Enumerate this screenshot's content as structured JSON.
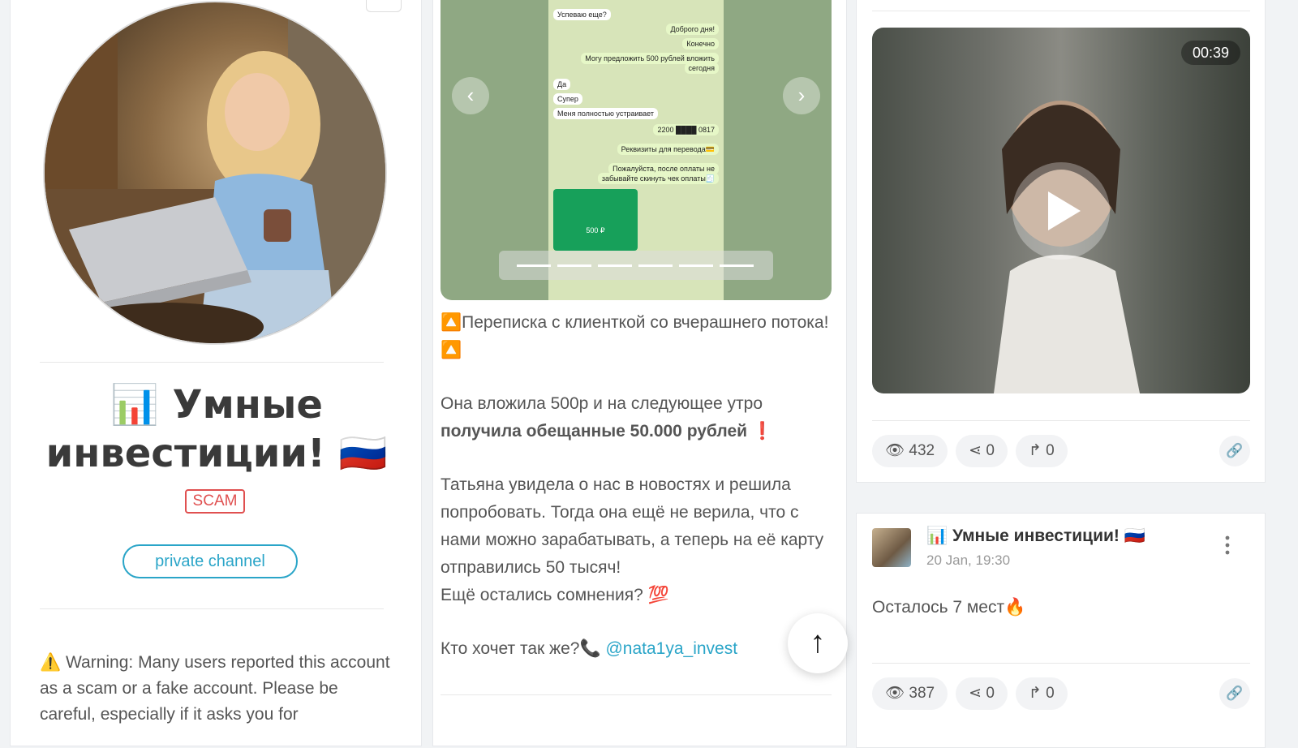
{
  "profile": {
    "channel_title": "📊 Умные инвестиции! 🇷🇺",
    "scam_badge": "SCAM",
    "private_button": "private channel",
    "warning_text": "⚠️ Warning: Many users reported this account as a scam or a fake account. Please be careful, especially if it asks you for",
    "more_menu": "⋮"
  },
  "carousel": {
    "chat": [
      {
        "text": "Успеваю еще?",
        "me": false
      },
      {
        "text": "Доброго дня!",
        "me": true
      },
      {
        "text": "Конечно",
        "me": true
      },
      {
        "text": "Могу предложить 500 рублей вложить",
        "me": true
      },
      {
        "text": "сегодня",
        "me": true
      },
      {
        "text": "Да",
        "me": false
      },
      {
        "text": "Супер",
        "me": false
      },
      {
        "text": "Меня полностью устраивает",
        "me": false
      },
      {
        "text": "2200 ████ 0817",
        "me": true
      },
      {
        "text": "Реквизиты для перевода💳",
        "me": true
      },
      {
        "text": "Пожалуйста, после оплаты не",
        "me": true
      },
      {
        "text": "забывайте скинуть чек оплаты🧾",
        "me": true
      }
    ],
    "receipt_amount": "500 ₽",
    "slides": 6,
    "prev_label": "‹",
    "next_label": "›"
  },
  "post": {
    "line1": "🔼Переписка с клиенткой со вчерашнего потока! 🔼",
    "line2a": "Она вложила 500р и на следующее утро",
    "line2b": "получила обещанные 50.000 рублей",
    "line2c": "❗",
    "line3": "Татьяна увидела о нас в новостях и решила попробовать. Тогда она ещё не верила, что с нами можно зарабатывать, а теперь на её карту отправились 50 тысяч!",
    "line4": "Ещё остались сомнения? 💯",
    "line5a": "Кто хочет так же?📞",
    "line5_link": "@nata1ya_invest",
    "scroll_top": "↑"
  },
  "video_post": {
    "duration": "00:39",
    "views": "432",
    "shares": "0",
    "forwards": "0"
  },
  "post2": {
    "channel": "📊 Умные инвестиции! 🇷🇺",
    "date": "20 Jan, 19:30",
    "text": "Осталось 7 мест🔥",
    "views": "387",
    "shares": "0",
    "forwards": "0"
  },
  "icons": {
    "eye": "👁",
    "share": "⋖",
    "forward": "↱",
    "link": "🔗"
  },
  "colors": {
    "accent": "#2aa5c8",
    "scam": "#e05050"
  }
}
